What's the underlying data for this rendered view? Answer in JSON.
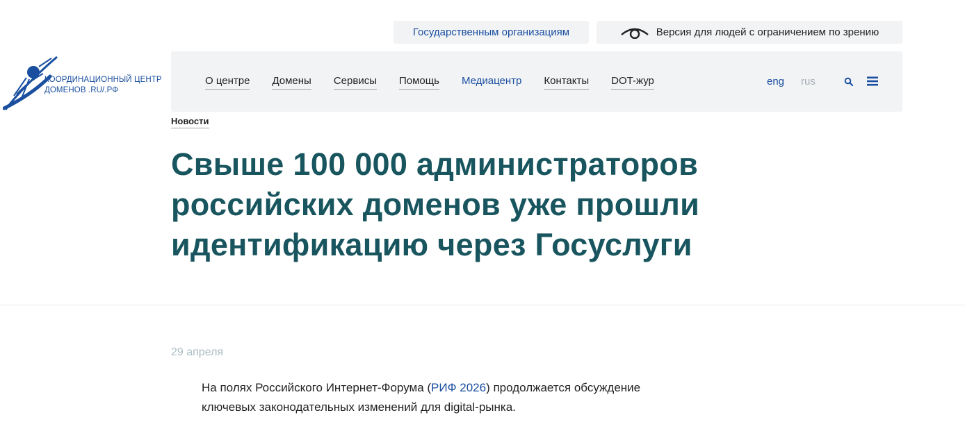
{
  "top_links": {
    "gov_label": "Государственным организациям",
    "vision_label": "Версия для людей с ограничением по зрению",
    "vision_icon": "eye-icon"
  },
  "logo": {
    "line1": "КООРДИНАЦИОННЫЙ ЦЕНТР",
    "line2": "ДОМЕНОВ .RU/.РФ",
    "icon": "sputnik-icon"
  },
  "nav": {
    "items": [
      {
        "label": "О центре"
      },
      {
        "label": "Домены"
      },
      {
        "label": "Сервисы"
      },
      {
        "label": "Помощь"
      },
      {
        "label": "Медиацентр",
        "active": true
      },
      {
        "label": "Контакты"
      },
      {
        "label": "DOT-жур"
      }
    ],
    "lang_eng": "eng",
    "lang_rus": "rus",
    "search_icon": "search-icon",
    "menu_icon": "hamburger-menu-icon"
  },
  "breadcrumb": "Новости",
  "article": {
    "title_line1": "Свыше 100 000 администраторов",
    "title_line2": "российских доменов уже прошли",
    "title_line3": "идентификацию через Госуслуги",
    "date": "29 апреля",
    "lead_before": "На полях Российского Интернет-Форума (",
    "lead_link": "РИФ 2026",
    "lead_after_line1": ") продолжается обсуждение",
    "lead_line2": "ключевых законодательных изменений для digital-рынка."
  },
  "colors": {
    "accent_blue": "#1a4fa0",
    "title_teal": "#18555e",
    "panel_gray": "#f2f3f5",
    "date_gray": "#a9bcc4"
  }
}
